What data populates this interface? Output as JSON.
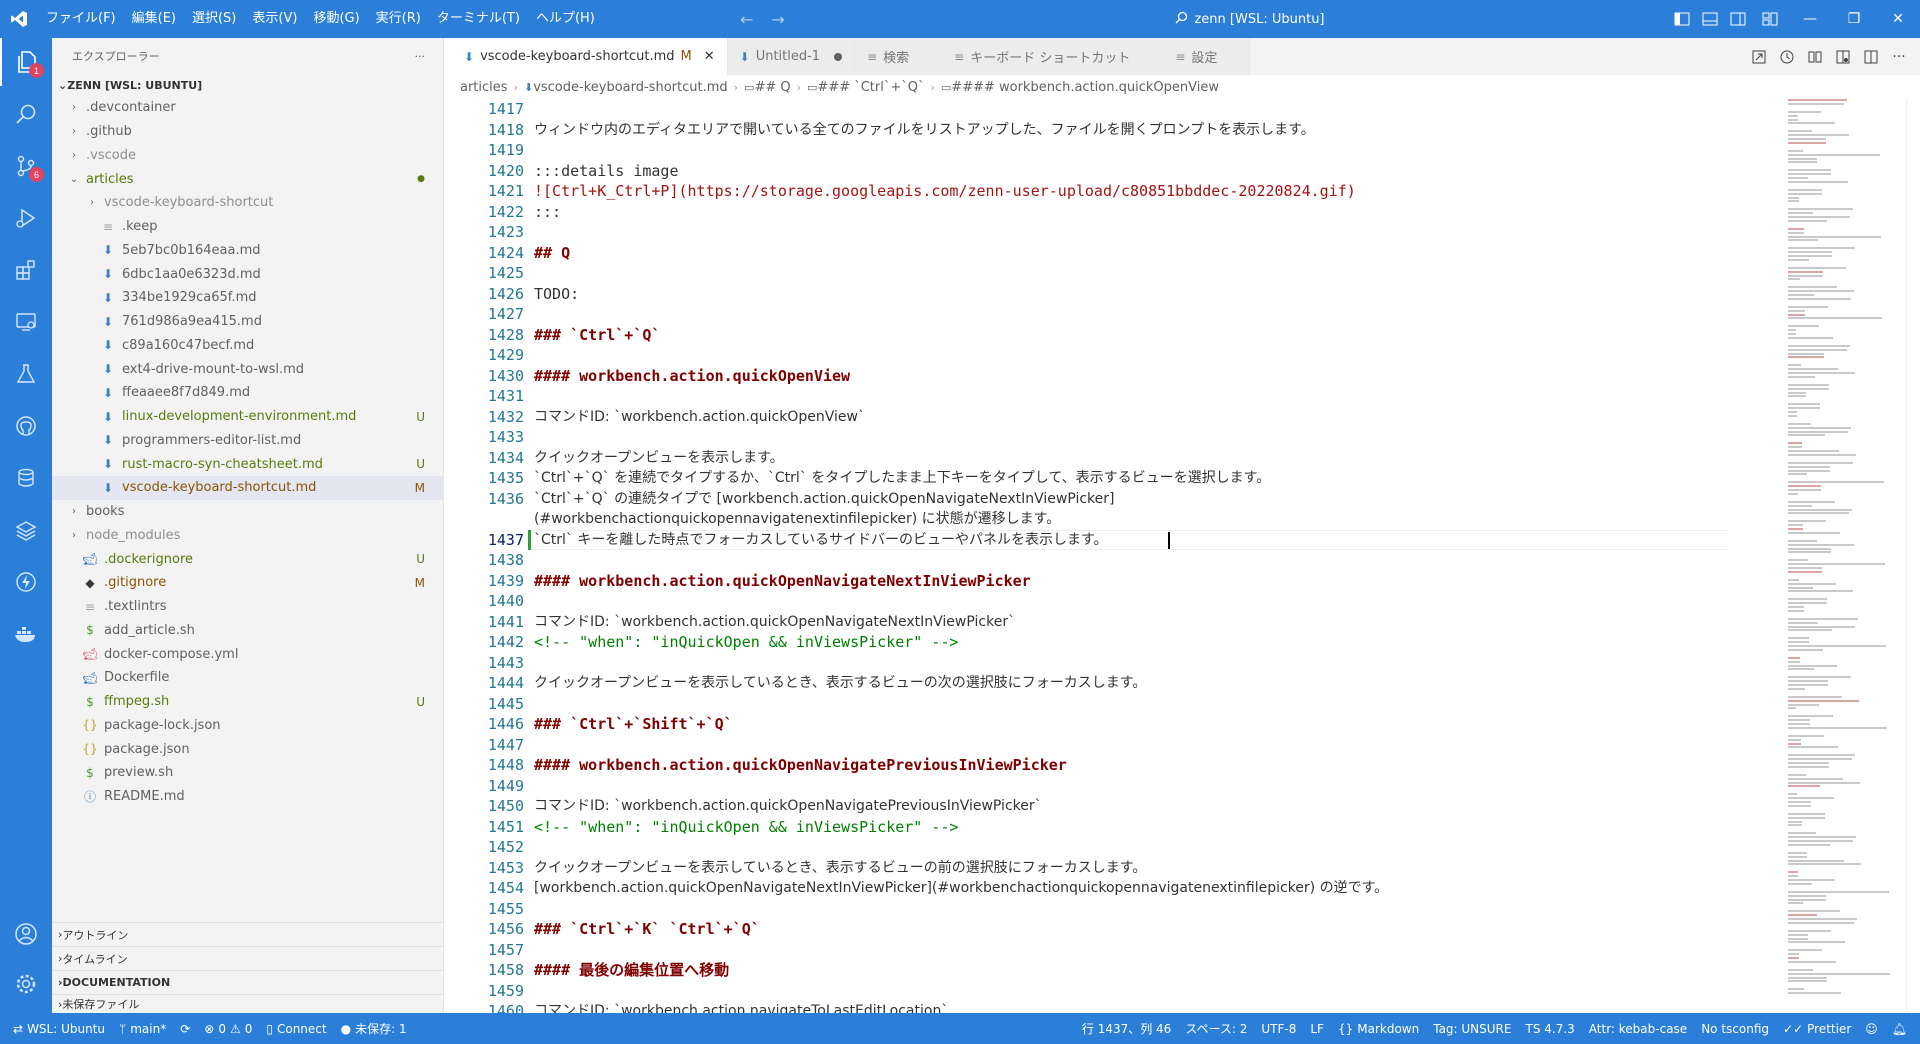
{
  "menu": [
    "ファイル(F)",
    "編集(E)",
    "選択(S)",
    "表示(V)",
    "移動(G)",
    "実行(R)",
    "ターミナル(T)",
    "ヘルプ(H)"
  ],
  "title_search": "zenn [WSL: Ubuntu]",
  "explorer": {
    "header": "エクスプローラー",
    "more": "···",
    "root": "ZENN [WSL: UBUNTU]",
    "items": [
      {
        "label": ".devcontainer",
        "kind": "folder",
        "depth": 0,
        "expanded": false,
        "status": "",
        "color": "default"
      },
      {
        "label": ".github",
        "kind": "folder",
        "depth": 0,
        "expanded": false,
        "status": "",
        "color": "default"
      },
      {
        "label": ".vscode",
        "kind": "folder",
        "depth": 0,
        "expanded": false,
        "status": "",
        "color": "dim"
      },
      {
        "label": "articles",
        "kind": "folder",
        "depth": 0,
        "expanded": true,
        "status": "●",
        "color": "u"
      },
      {
        "label": "vscode-keyboard-shortcut",
        "kind": "folder",
        "depth": 1,
        "expanded": false,
        "status": "",
        "color": "dim"
      },
      {
        "label": ".keep",
        "kind": "file",
        "depth": 1,
        "status": "",
        "color": "default"
      },
      {
        "label": "5eb7bc0b164eaa.md",
        "kind": "md",
        "depth": 1,
        "status": "",
        "color": "default"
      },
      {
        "label": "6dbc1aa0e6323d.md",
        "kind": "md",
        "depth": 1,
        "status": "",
        "color": "default"
      },
      {
        "label": "334be1929ca65f.md",
        "kind": "md",
        "depth": 1,
        "status": "",
        "color": "default"
      },
      {
        "label": "761d986a9ea415.md",
        "kind": "md",
        "depth": 1,
        "status": "",
        "color": "default"
      },
      {
        "label": "c89a160c47becf.md",
        "kind": "md",
        "depth": 1,
        "status": "",
        "color": "default"
      },
      {
        "label": "ext4-drive-mount-to-wsl.md",
        "kind": "md",
        "depth": 1,
        "status": "",
        "color": "default"
      },
      {
        "label": "ffeaaee8f7d849.md",
        "kind": "md",
        "depth": 1,
        "status": "",
        "color": "default"
      },
      {
        "label": "linux-development-environment.md",
        "kind": "md",
        "depth": 1,
        "status": "U",
        "color": "u"
      },
      {
        "label": "programmers-editor-list.md",
        "kind": "md",
        "depth": 1,
        "status": "",
        "color": "default"
      },
      {
        "label": "rust-macro-syn-cheatsheet.md",
        "kind": "md",
        "depth": 1,
        "status": "U",
        "color": "u"
      },
      {
        "label": "vscode-keyboard-shortcut.md",
        "kind": "md",
        "depth": 1,
        "status": "M",
        "color": "m",
        "selected": true
      },
      {
        "label": "books",
        "kind": "folder",
        "depth": 0,
        "expanded": false,
        "status": "",
        "color": "default"
      },
      {
        "label": "node_modules",
        "kind": "folder",
        "depth": 0,
        "expanded": false,
        "status": "",
        "color": "dim"
      },
      {
        "label": ".dockerignore",
        "kind": "docker",
        "depth": 0,
        "status": "U",
        "color": "u"
      },
      {
        "label": ".gitignore",
        "kind": "git",
        "depth": 0,
        "status": "M",
        "color": "m"
      },
      {
        "label": ".textlintrs",
        "kind": "file",
        "depth": 0,
        "status": "",
        "color": "default"
      },
      {
        "label": "add_article.sh",
        "kind": "sh",
        "depth": 0,
        "status": "",
        "color": "default"
      },
      {
        "label": "docker-compose.yml",
        "kind": "yml",
        "depth": 0,
        "status": "",
        "color": "default"
      },
      {
        "label": "Dockerfile",
        "kind": "docker",
        "depth": 0,
        "status": "",
        "color": "default"
      },
      {
        "label": "ffmpeg.sh",
        "kind": "sh",
        "depth": 0,
        "status": "U",
        "color": "u"
      },
      {
        "label": "package-lock.json",
        "kind": "json",
        "depth": 0,
        "status": "",
        "color": "default"
      },
      {
        "label": "package.json",
        "kind": "json",
        "depth": 0,
        "status": "",
        "color": "default"
      },
      {
        "label": "preview.sh",
        "kind": "sh",
        "depth": 0,
        "status": "",
        "color": "default"
      },
      {
        "label": "README.md",
        "kind": "info",
        "depth": 0,
        "status": "",
        "color": "default"
      }
    ],
    "sections": [
      "アウトライン",
      "タイムライン",
      "DOCUMENTATION",
      "未保存ファイル"
    ]
  },
  "tabs": [
    {
      "label": "vscode-keyboard-shortcut.md",
      "suffix": "M",
      "active": true,
      "icon": "markdown-icon"
    },
    {
      "label": "Untitled-1",
      "suffix": "",
      "active": false,
      "icon": "markdown-icon",
      "dirty": true
    },
    {
      "label": "検索",
      "suffix": "",
      "active": false,
      "icon": "search-tab-icon"
    },
    {
      "label": "キーボード ショートカット",
      "suffix": "",
      "active": false,
      "icon": "keyboard-tab-icon"
    },
    {
      "label": "設定",
      "suffix": "",
      "active": false,
      "icon": "settings-tab-icon"
    }
  ],
  "breadcrumb": [
    "articles",
    "vscode-keyboard-shortcut.md",
    "## Q",
    "### `Ctrl`+`Q`",
    "#### workbench.action.quickOpenView"
  ],
  "editor": {
    "current_line": 1437,
    "lines": [
      {
        "n": 1417,
        "t": ""
      },
      {
        "n": 1418,
        "t": "ウィンドウ内のエディタエリアで開いている全てのファイルをリストアップした、ファイルを開くプロンプトを表示します。",
        "jp": true
      },
      {
        "n": 1419,
        "t": ""
      },
      {
        "n": 1420,
        "t": ":::details image"
      },
      {
        "n": 1421,
        "t": "![Ctrl+K_Ctrl+P](https://storage.googleapis.com/zenn-user-upload/c80851bbddec-20220824.gif)",
        "style": "image"
      },
      {
        "n": 1422,
        "t": ":::"
      },
      {
        "n": 1423,
        "t": ""
      },
      {
        "n": 1424,
        "t": "## Q",
        "style": "heading"
      },
      {
        "n": 1425,
        "t": ""
      },
      {
        "n": 1426,
        "t": "TODO:"
      },
      {
        "n": 1427,
        "t": ""
      },
      {
        "n": 1428,
        "t": "### `Ctrl`+`Q`",
        "style": "heading"
      },
      {
        "n": 1429,
        "t": ""
      },
      {
        "n": 1430,
        "t": "#### workbench.action.quickOpenView",
        "style": "heading"
      },
      {
        "n": 1431,
        "t": ""
      },
      {
        "n": 1432,
        "t": "コマンドID: `workbench.action.quickOpenView`",
        "jp": true
      },
      {
        "n": 1433,
        "t": ""
      },
      {
        "n": 1434,
        "t": "クイックオープンビューを表示します。",
        "jp": true
      },
      {
        "n": 1435,
        "t": "`Ctrl`+`Q` を連続でタイプするか、`Ctrl` をタイプしたまま上下キーをタイプして、表示するビューを選択します。",
        "jp": true
      },
      {
        "n": 1436,
        "t": "`Ctrl`+`Q` の連続タイプで [workbench.action.quickOpenNavigateNextInViewPicker]",
        "jp": true,
        "style": "link-tail"
      },
      {
        "n": 0,
        "t": "(#workbenchactionquickopennavigatenextinfilepicker) に状態が遷移します。",
        "jp": true,
        "style": "paren-url",
        "wrap": true
      },
      {
        "n": 1437,
        "t": "`Ctrl` キーを離した時点でフォーカスしているサイドバーのビューやパネルを表示します。",
        "jp": true,
        "cursor": true
      },
      {
        "n": 1438,
        "t": ""
      },
      {
        "n": 1439,
        "t": "#### workbench.action.quickOpenNavigateNextInViewPicker",
        "style": "heading"
      },
      {
        "n": 1440,
        "t": ""
      },
      {
        "n": 1441,
        "t": "コマンドID: `workbench.action.quickOpenNavigateNextInViewPicker`",
        "jp": true
      },
      {
        "n": 1442,
        "t": "<!-- \"when\": \"inQuickOpen && inViewsPicker\" -->",
        "style": "comment"
      },
      {
        "n": 1443,
        "t": ""
      },
      {
        "n": 1444,
        "t": "クイックオープンビューを表示しているとき、表示するビューの次の選択肢にフォーカスします。",
        "jp": true
      },
      {
        "n": 1445,
        "t": ""
      },
      {
        "n": 1446,
        "t": "### `Ctrl`+`Shift`+`Q`",
        "style": "heading"
      },
      {
        "n": 1447,
        "t": ""
      },
      {
        "n": 1448,
        "t": "#### workbench.action.quickOpenNavigatePreviousInViewPicker",
        "style": "heading"
      },
      {
        "n": 1449,
        "t": ""
      },
      {
        "n": 1450,
        "t": "コマンドID: `workbench.action.quickOpenNavigatePreviousInViewPicker`",
        "jp": true
      },
      {
        "n": 1451,
        "t": "<!-- \"when\": \"inQuickOpen && inViewsPicker\" -->",
        "style": "comment"
      },
      {
        "n": 1452,
        "t": ""
      },
      {
        "n": 1453,
        "t": "クイックオープンビューを表示しているとき、表示するビューの前の選択肢にフォーカスします。",
        "jp": true
      },
      {
        "n": 1454,
        "t": "[workbench.action.quickOpenNavigateNextInViewPicker](#workbenchactionquickopennavigatenextinfilepicker) の逆です。",
        "jp": true,
        "style": "link-full"
      },
      {
        "n": 1455,
        "t": ""
      },
      {
        "n": 1456,
        "t": "### `Ctrl`+`K` `Ctrl`+`Q`",
        "style": "heading"
      },
      {
        "n": 1457,
        "t": ""
      },
      {
        "n": 1458,
        "t": "#### 最後の編集位置へ移動",
        "style": "heading"
      },
      {
        "n": 1459,
        "t": ""
      },
      {
        "n": 1460,
        "t": "コマンドID: `workbench.action.navigateToLastEditLocation`",
        "jp": true
      }
    ]
  },
  "status": {
    "remote": "WSL: Ubuntu",
    "branch": "main*",
    "sync": "",
    "errors": "0",
    "warnings": "0",
    "connect": "Connect",
    "unsaved": "未保存: 1",
    "position": "行 1437、列 46",
    "spaces": "スペース: 2",
    "encoding": "UTF-8",
    "eol": "LF",
    "language": "Markdown",
    "tag": "Tag: UNSURE",
    "ts": "TS 4.7.3",
    "attr": "Attr: kebab-case",
    "tsconfig": "No tsconfig",
    "prettier": "Prettier"
  },
  "colors": {
    "accent": "#2b7fd9",
    "git_untracked": "#587c0c",
    "git_modified": "#895503"
  }
}
